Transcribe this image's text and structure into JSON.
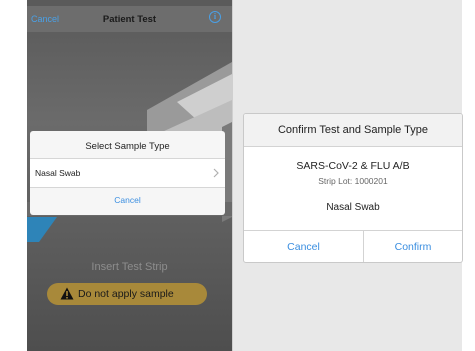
{
  "left_screen": {
    "nav": {
      "cancel_label": "Cancel",
      "title": "Patient Test",
      "info_icon": "info-icon"
    },
    "sample_dialog": {
      "title": "Select Sample Type",
      "option_label": "Nasal Swab",
      "cancel_label": "Cancel"
    },
    "instruction": "Insert Test Strip",
    "warning": {
      "icon": "warning-triangle-icon",
      "text": "Do not apply sample"
    }
  },
  "right_screen": {
    "confirm_dialog": {
      "title": "Confirm Test and Sample Type",
      "test_name": "SARS-CoV-2 & FLU A/B",
      "strip_lot": "Strip Lot: 1000201",
      "sample_type": "Nasal Swab",
      "cancel_label": "Cancel",
      "confirm_label": "Confirm"
    }
  },
  "colors": {
    "accent_blue": "#3a8ee0",
    "warning_pill": "#a8893a",
    "device_teal": "#2e84b8"
  }
}
